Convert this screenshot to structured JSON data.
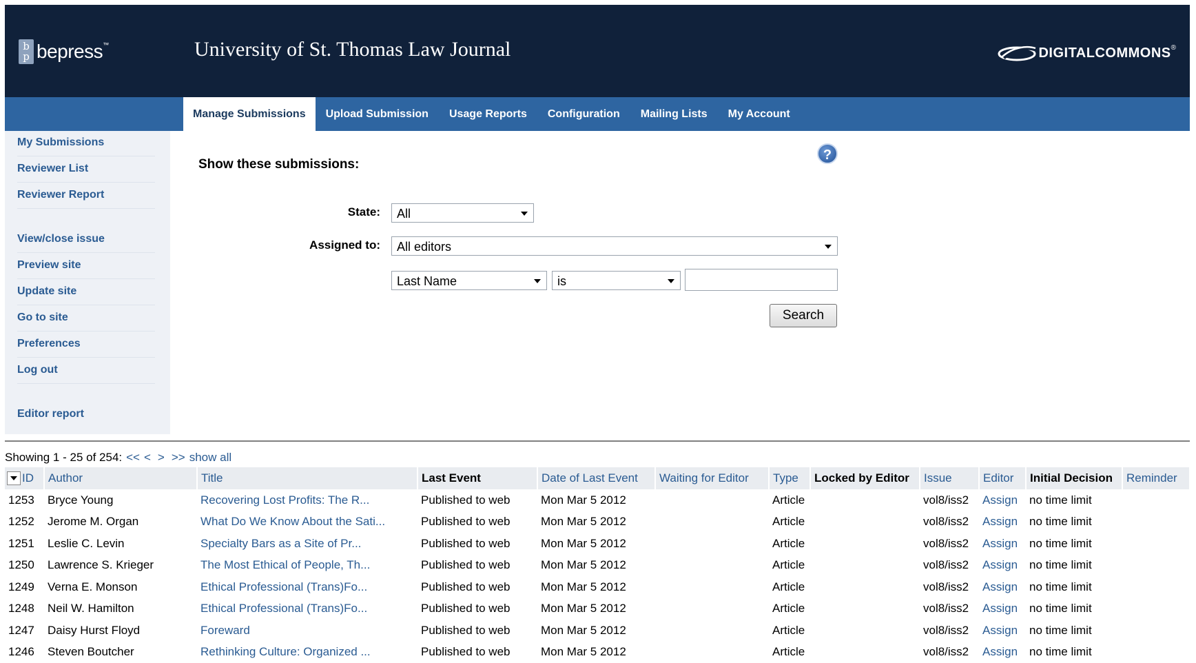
{
  "header": {
    "logo": "bepress",
    "logo_tm": "™",
    "journal_title": "University of St. Thomas Law Journal",
    "partner_logo": "DIGITALCOMMONS",
    "partner_tm": "®"
  },
  "tabs": [
    "Manage Submissions",
    "Upload Submission",
    "Usage Reports",
    "Configuration",
    "Mailing Lists",
    "My Account"
  ],
  "active_tab": "Manage Submissions",
  "sidebar": [
    "My Submissions",
    "Reviewer List",
    "Reviewer Report",
    "View/close issue",
    "Preview site",
    "Update site",
    "Go to site",
    "Preferences",
    "Log out",
    "Editor report"
  ],
  "filter": {
    "title": "Show these submissions:",
    "help_icon": "question-icon",
    "state_label": "State:",
    "state_value": "All",
    "assigned_label": "Assigned to:",
    "assigned_value": "All editors",
    "field_value": "Last Name",
    "operator_value": "is",
    "search_value": "",
    "search_button": "Search"
  },
  "pager": {
    "showing": "Showing 1 - 25 of 254:",
    "first": "<<",
    "prev": "<",
    "next": ">",
    "last": ">>",
    "show_all": "show all"
  },
  "table": {
    "columns": [
      "ID",
      "Author",
      "Title",
      "Last Event",
      "Date of Last Event",
      "Waiting for Editor",
      "Type",
      "Locked by Editor",
      "Issue",
      "Editor",
      "Initial Decision",
      "Reminder"
    ],
    "rows": [
      [
        "1253",
        "Bryce Young",
        "Recovering Lost Profits: The R...",
        "Published to web",
        "Mon Mar 5 2012",
        "",
        "Article",
        "",
        "vol8/iss2",
        "Assign",
        "no time limit",
        ""
      ],
      [
        "1252",
        "Jerome M. Organ",
        "What Do We Know About the Sati...",
        "Published to web",
        "Mon Mar 5 2012",
        "",
        "Article",
        "",
        "vol8/iss2",
        "Assign",
        "no time limit",
        ""
      ],
      [
        "1251",
        "Leslie C. Levin",
        "Specialty Bars as a Site of Pr...",
        "Published to web",
        "Mon Mar 5 2012",
        "",
        "Article",
        "",
        "vol8/iss2",
        "Assign",
        "no time limit",
        ""
      ],
      [
        "1250",
        "Lawrence S. Krieger",
        "The Most Ethical of People, Th...",
        "Published to web",
        "Mon Mar 5 2012",
        "",
        "Article",
        "",
        "vol8/iss2",
        "Assign",
        "no time limit",
        ""
      ],
      [
        "1249",
        "Verna E. Monson",
        "Ethical Professional (Trans)Fo...",
        "Published to web",
        "Mon Mar 5 2012",
        "",
        "Article",
        "",
        "vol8/iss2",
        "Assign",
        "no time limit",
        ""
      ],
      [
        "1248",
        "Neil W. Hamilton",
        "Ethical Professional (Trans)Fo...",
        "Published to web",
        "Mon Mar 5 2012",
        "",
        "Article",
        "",
        "vol8/iss2",
        "Assign",
        "no time limit",
        ""
      ],
      [
        "1247",
        "Daisy Hurst Floyd",
        "Foreward",
        "Published to web",
        "Mon Mar 5 2012",
        "",
        "Article",
        "",
        "vol8/iss2",
        "Assign",
        "no time limit",
        ""
      ],
      [
        "1246",
        "Steven Boutcher",
        "Rethinking Culture: Organized ...",
        "Published to web",
        "Mon Mar 5 2012",
        "",
        "Article",
        "",
        "vol8/iss2",
        "Assign",
        "no time limit",
        ""
      ]
    ]
  },
  "colors": {
    "header_bg": "#10213a",
    "nav_bg": "#2e65a1",
    "link": "#2a5b92",
    "sidebar_bg": "#eef1f6"
  }
}
